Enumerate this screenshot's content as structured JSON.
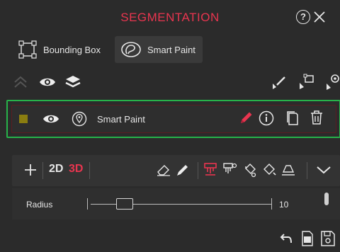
{
  "header": {
    "title": "SEGMENTATION",
    "help_label": "?"
  },
  "tools": {
    "bounding_box_label": "Bounding Box",
    "smart_paint_label": "Smart Paint"
  },
  "layer": {
    "name": "Smart Paint",
    "swatch_color": "#8a7d10"
  },
  "toolbar": {
    "label_2d": "2D",
    "label_3d": "3D"
  },
  "radius": {
    "label": "Radius",
    "value": "10",
    "slider_fraction": 0.2
  },
  "colors": {
    "accent": "#e8354f",
    "selection": "#27b34a",
    "panel": "#2b2b2b"
  },
  "icons": [
    "close-icon",
    "bounding-box-icon",
    "smart-paint-icon",
    "collapse-up-icon",
    "eye-icon",
    "layers-icon",
    "brush-pointer-icon",
    "box-pointer-icon",
    "target-pointer-icon",
    "location-pin-icon",
    "pencil-icon",
    "info-icon",
    "copy-icon",
    "trash-icon",
    "plus-icon",
    "eraser-icon",
    "paint-brush-icon",
    "brush-settings-icon",
    "fill-bucket-icon",
    "fill-bucket-alt-icon",
    "threshold-icon",
    "chevron-down-icon",
    "undo-icon",
    "export-icon",
    "save-icon"
  ]
}
